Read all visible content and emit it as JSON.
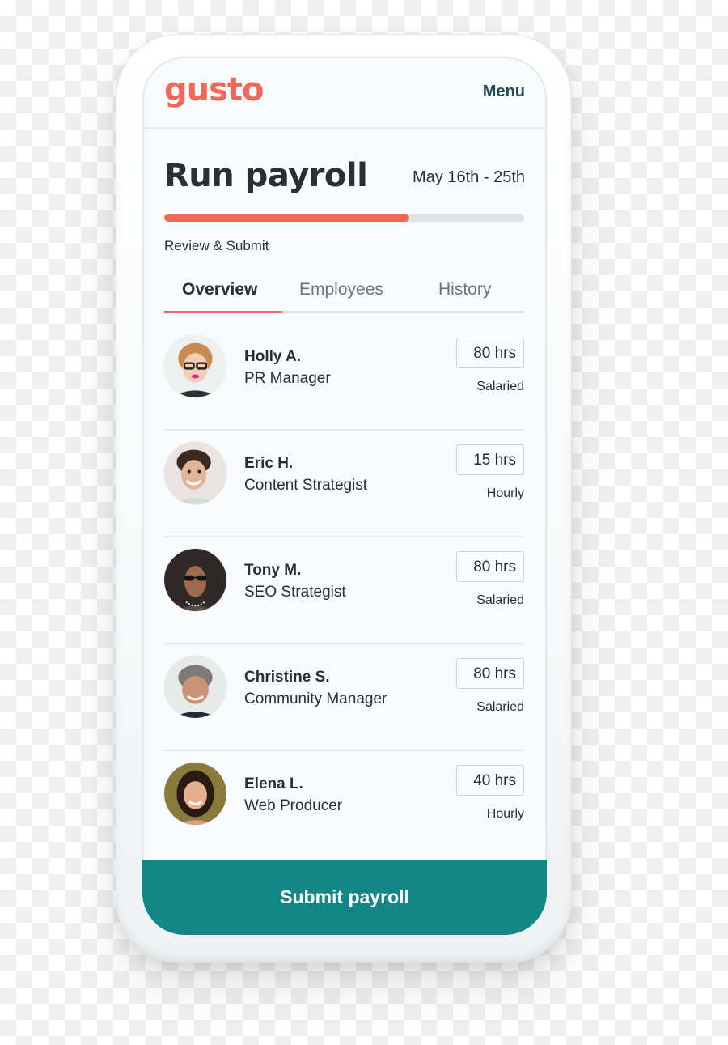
{
  "app": {
    "logo": "gusto",
    "menu_label": "Menu"
  },
  "page": {
    "title": "Run payroll",
    "date_range": "May 16th - 25th",
    "progress_percent": 68,
    "step_label": "Review & Submit"
  },
  "tabs": [
    {
      "label": "Overview",
      "active": true
    },
    {
      "label": "Employees",
      "active": false
    },
    {
      "label": "History",
      "active": false
    }
  ],
  "employees": [
    {
      "name": "Holly A.",
      "role": "PR Manager",
      "hours": "80 hrs",
      "pay_type": "Salaried",
      "avatar": "photo-holly"
    },
    {
      "name": "Eric H.",
      "role": "Content Strategist",
      "hours": "15 hrs",
      "pay_type": "Hourly",
      "avatar": "photo-eric"
    },
    {
      "name": "Tony M.",
      "role": "SEO Strategist",
      "hours": "80 hrs",
      "pay_type": "Salaried",
      "avatar": "photo-tony"
    },
    {
      "name": "Christine S.",
      "role": "Community Manager",
      "hours": "80 hrs",
      "pay_type": "Salaried",
      "avatar": "photo-christine"
    },
    {
      "name": "Elena L.",
      "role": "Web Producer",
      "hours": "40 hrs",
      "pay_type": "Hourly",
      "avatar": "photo-elena"
    }
  ],
  "submit_label": "Submit payroll",
  "colors": {
    "brand": "#f0685a",
    "accent": "#138686",
    "menu": "#1e4d58"
  }
}
